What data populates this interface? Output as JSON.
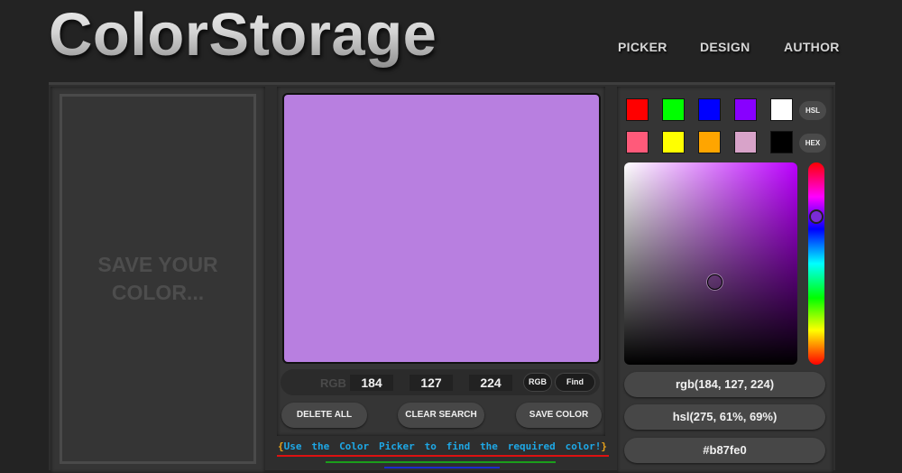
{
  "header": {
    "logo": "ColorStorage",
    "nav": [
      "PICKER",
      "DESIGN",
      "AUTHOR"
    ]
  },
  "saved": {
    "placeholder": "SAVE YOUR COLOR..."
  },
  "preview": {
    "color": "#b87fe0"
  },
  "rgb_search": {
    "label": "RGB",
    "r": "184",
    "g": "127",
    "b": "224",
    "mode_button": "RGB",
    "find_button": "Find"
  },
  "actions": {
    "delete_all": "DELETE ALL",
    "clear_search": "CLEAR SEARCH",
    "save_color": "SAVE COLOR"
  },
  "hint": {
    "open": "{",
    "words": [
      "Use",
      "the",
      "Color",
      "Picker",
      "to",
      "find",
      "the",
      "required",
      "color!"
    ],
    "close": "}"
  },
  "picker": {
    "swatches": [
      "#ff0000",
      "#00ff00",
      "#0000ff",
      "#8800ff",
      "#ffffff",
      "#ff5a7a",
      "#ffff00",
      "#ffa500",
      "#d8a3c9",
      "#000000"
    ],
    "format_buttons": [
      "HSL",
      "HEX"
    ],
    "rgb": "rgb(184, 127, 224)",
    "hsl": "hsl(275, 61%, 69%)",
    "hex": "#b87fe0"
  }
}
